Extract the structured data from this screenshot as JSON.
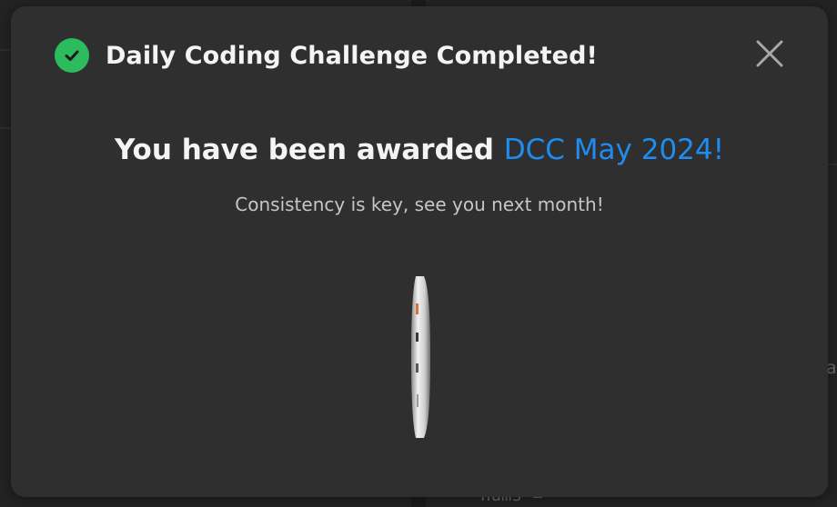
{
  "background": {
    "code_snippet": "nums ="
  },
  "modal": {
    "title": "Daily Coding Challenge Completed!",
    "award_prefix": "You have been awarded ",
    "award_badge": "DCC May 2024!",
    "subtitle": "Consistency is key, see you next month!",
    "icons": {
      "status": "check-circle-icon",
      "close": "close-icon",
      "medal": "medal-icon"
    }
  },
  "colors": {
    "success": "#2cbb5d",
    "accent": "#1f8cf2",
    "modal_bg": "#2f2f2f"
  }
}
